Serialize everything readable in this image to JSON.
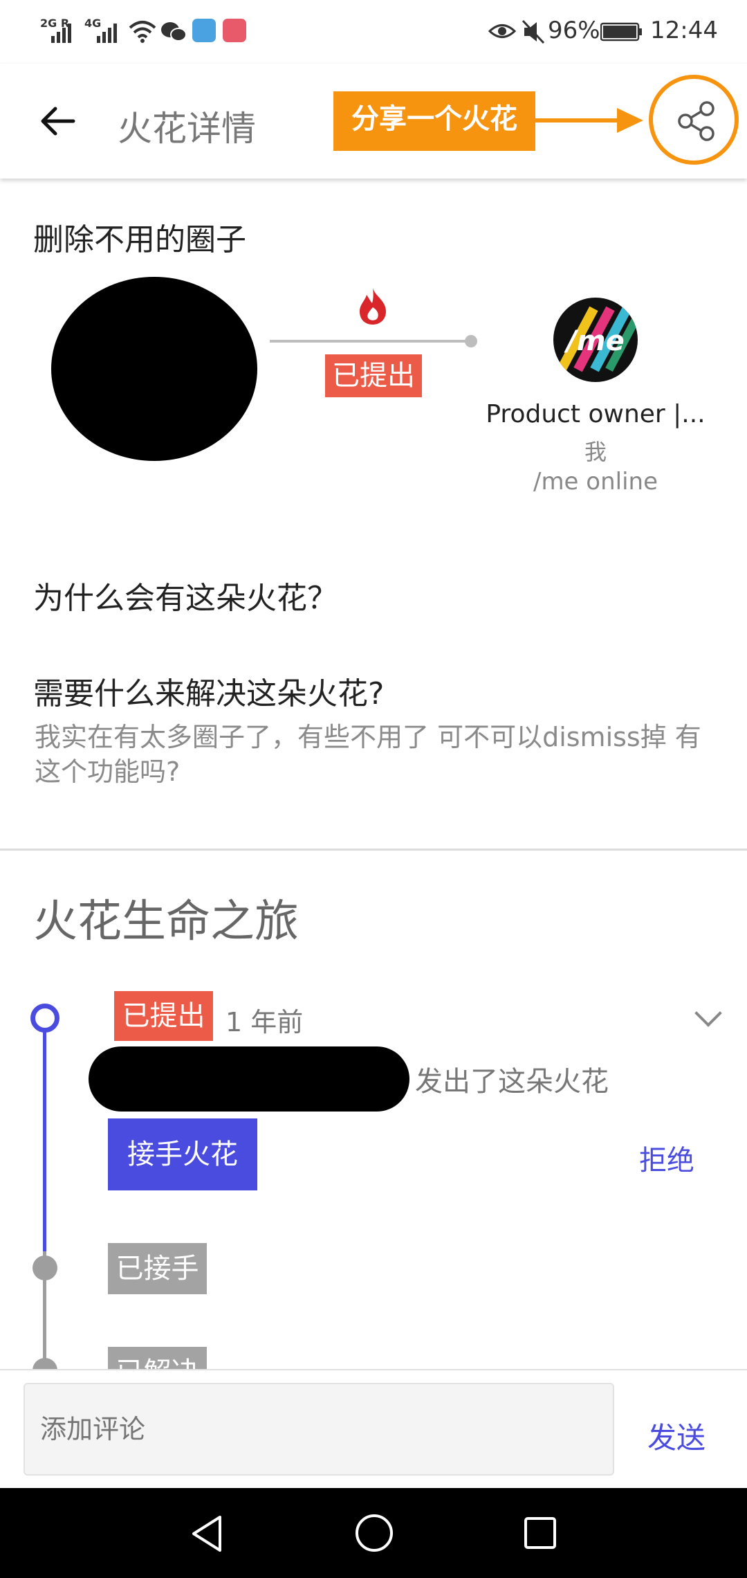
{
  "status_bar": {
    "net1": "2G R",
    "net2": "4G",
    "battery": "96%",
    "time": "12:44"
  },
  "header": {
    "title": "火花详情",
    "callout": "分享一个火花"
  },
  "spark": {
    "title": "删除不用的圈子",
    "status": "已提出",
    "owner": {
      "name": "Product owner |...",
      "role": "我",
      "org": "/me online",
      "avatar_text": "/me"
    }
  },
  "questions": {
    "why": "为什么会有这朵火花？",
    "need": "需要什么来解决这朵火花?",
    "answer": "我实在有太多圈子了，有些不用了 可不可以dismiss掉 有这个功能吗?"
  },
  "journey": {
    "title": "火花生命之旅",
    "step1": {
      "tag": "已提出",
      "time": "1 年前",
      "text": "发出了这朵火花"
    },
    "accept_label": "接手火花",
    "reject_label": "拒绝",
    "step2": {
      "tag": "已接手"
    },
    "step3": {
      "tag": "已解决"
    }
  },
  "comment": {
    "placeholder": "添加评论",
    "send": "发送"
  },
  "colors": {
    "accent": "#4a4ce0",
    "status_red": "#ec5b47",
    "callout_orange": "#f7940f",
    "grey_tag": "#a3a3a3"
  }
}
